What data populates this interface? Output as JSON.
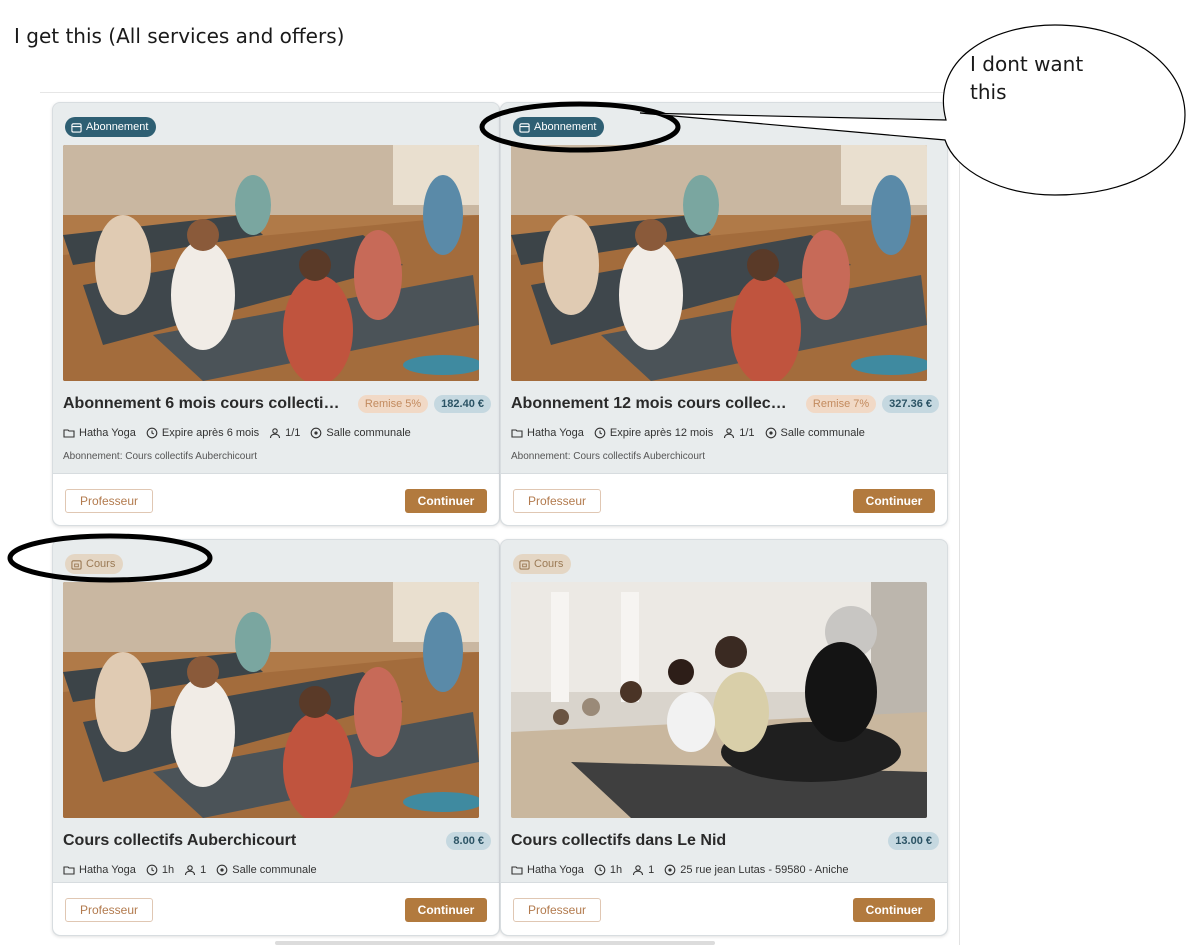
{
  "note": "I get this (All services and offers)",
  "callout": "I dont want this",
  "colors": {
    "badge_dark": "#2e5f73",
    "badge_light": "#e4d6c4",
    "continue_button": "#b27a3e",
    "price_pill": "#c5d8e0",
    "discount_pill": "#f1d9c6"
  },
  "cards": [
    {
      "badge": "Abonnement",
      "badge_icon": "calendar-icon",
      "image": "yoga class photo",
      "title": "Abonnement 6 mois cours collectif à ...",
      "discount": "Remise 5%",
      "price": "182.40 €",
      "category": "Hatha Yoga",
      "duration": "Expire après 6 mois",
      "capacity": "1/1",
      "location": "Salle communale",
      "subtitle": "Abonnement: Cours collectifs Auberchicourt",
      "btn_teacher": "Professeur",
      "btn_continue": "Continuer"
    },
    {
      "badge": "Abonnement",
      "badge_icon": "calendar-icon",
      "image": "yoga class photo",
      "title": "Abonnement 12 mois cours collectif à...",
      "discount": "Remise 7%",
      "price": "327.36 €",
      "category": "Hatha Yoga",
      "duration": "Expire après 12 mois",
      "capacity": "1/1",
      "location": "Salle communale",
      "subtitle": "Abonnement: Cours collectifs Auberchicourt",
      "btn_teacher": "Professeur",
      "btn_continue": "Continuer"
    },
    {
      "badge": "Cours",
      "badge_icon": "calendar-icon",
      "image": "yoga class photo",
      "title": "Cours collectifs Auberchicourt",
      "price": "8.00 €",
      "category": "Hatha Yoga",
      "duration": "1h",
      "capacity": "1",
      "location": "Salle communale",
      "btn_teacher": "Professeur",
      "btn_continue": "Continuer"
    },
    {
      "badge": "Cours",
      "badge_icon": "calendar-icon",
      "image": "yoga studio cobra pose photo",
      "title": "Cours collectifs dans Le Nid",
      "price": "13.00 €",
      "category": "Hatha Yoga",
      "duration": "1h",
      "capacity": "1",
      "location": "25 rue jean Lutas - 59580 - Aniche",
      "btn_teacher": "Professeur",
      "btn_continue": "Continuer"
    }
  ]
}
